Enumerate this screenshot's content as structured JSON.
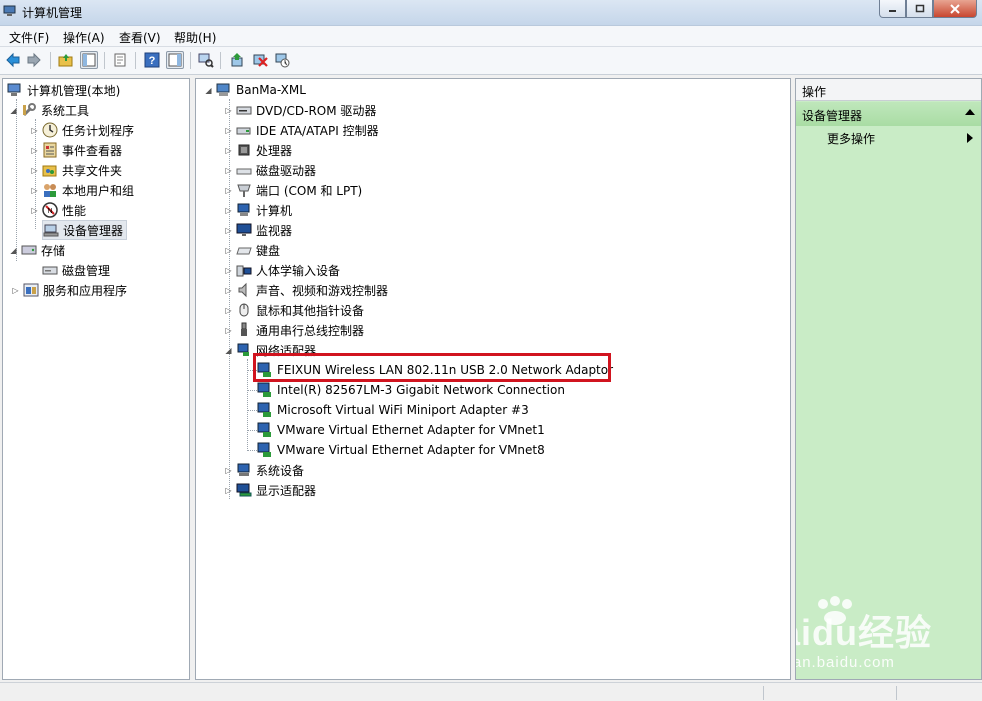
{
  "window": {
    "title": "计算机管理"
  },
  "menu": [
    "文件(F)",
    "操作(A)",
    "查看(V)",
    "帮助(H)"
  ],
  "left_tree": [
    {
      "label": "计算机管理(本地)",
      "icon": "computer-management-icon"
    },
    {
      "label": "系统工具",
      "icon": "system-tools-icon"
    },
    {
      "label": "任务计划程序",
      "icon": "clock-icon"
    },
    {
      "label": "事件查看器",
      "icon": "event-viewer-icon"
    },
    {
      "label": "共享文件夹",
      "icon": "shared-folder-icon"
    },
    {
      "label": "本地用户和组",
      "icon": "users-icon"
    },
    {
      "label": "性能",
      "icon": "performance-icon"
    },
    {
      "label": "设备管理器",
      "icon": "device-manager-icon"
    },
    {
      "label": "存储",
      "icon": "storage-icon"
    },
    {
      "label": "磁盘管理",
      "icon": "disk-icon"
    },
    {
      "label": "服务和应用程序",
      "icon": "services-icon"
    }
  ],
  "device_tree": {
    "root": "BanMa-XML",
    "categories": [
      {
        "label": "DVD/CD-ROM 驱动器",
        "icon": "dvd-icon"
      },
      {
        "label": "IDE ATA/ATAPI 控制器",
        "icon": "ide-controller-icon"
      },
      {
        "label": "处理器",
        "icon": "processor-icon"
      },
      {
        "label": "磁盘驱动器",
        "icon": "disk-drive-icon"
      },
      {
        "label": "端口 (COM 和 LPT)",
        "icon": "port-icon"
      },
      {
        "label": "计算机",
        "icon": "computer-icon"
      },
      {
        "label": "监视器",
        "icon": "monitor-icon"
      },
      {
        "label": "键盘",
        "icon": "keyboard-icon"
      },
      {
        "label": "人体学输入设备",
        "icon": "hid-icon"
      },
      {
        "label": "声音、视频和游戏控制器",
        "icon": "sound-icon"
      },
      {
        "label": "鼠标和其他指针设备",
        "icon": "mouse-icon"
      },
      {
        "label": "通用串行总线控制器",
        "icon": "usb-icon"
      },
      {
        "label": "网络适配器",
        "icon": "network-adapter-icon"
      }
    ],
    "network_adapters": [
      "FEIXUN Wireless LAN 802.11n USB 2.0 Network Adaptor",
      "Intel(R) 82567LM-3 Gigabit Network Connection",
      "Microsoft Virtual WiFi Miniport Adapter #3",
      "VMware Virtual Ethernet Adapter for VMnet1",
      "VMware Virtual Ethernet Adapter for VMnet8"
    ],
    "after": [
      {
        "label": "系统设备",
        "icon": "system-device-icon"
      },
      {
        "label": "显示适配器",
        "icon": "display-adapter-icon"
      }
    ]
  },
  "actions": {
    "header": "操作",
    "group": "设备管理器",
    "item": "更多操作"
  },
  "watermark": {
    "logo": "Baidu经验",
    "url": "jingyan.baidu.com"
  },
  "colors": {
    "action_pane": "#c9ecc6",
    "highlight": "#d1141f"
  }
}
